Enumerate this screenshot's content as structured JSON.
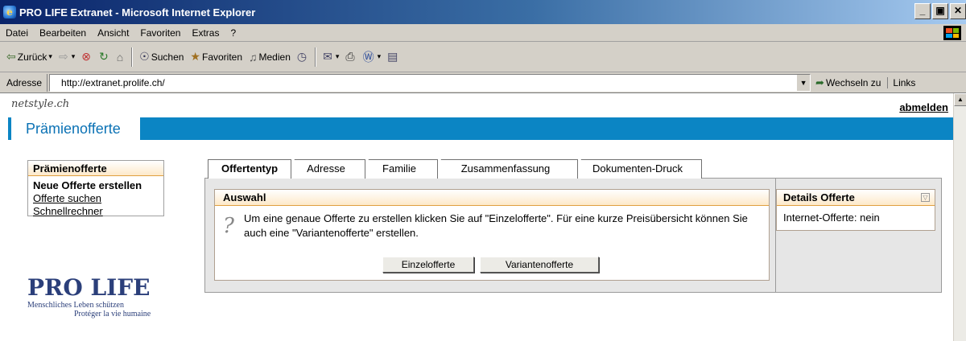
{
  "window": {
    "title": "PRO LIFE Extranet - Microsoft Internet Explorer",
    "controls": [
      "_",
      "&#x25A1;",
      "x"
    ]
  },
  "menu": [
    "Datei",
    "Bearbeiten",
    "Ansicht",
    "Favoriten",
    "Extras",
    "?"
  ],
  "toolbar": {
    "back": "Zurück",
    "search": "Suchen",
    "favorites": "Favoriten",
    "media": "Medien"
  },
  "address": {
    "label": "Adresse",
    "url": "http://extranet.prolife.ch/",
    "go": "Wechseln zu",
    "links": "Links"
  },
  "page": {
    "brand": "netstyle.ch",
    "logout": "abmelden",
    "banner_title": "Prämienofferte",
    "sidebar": {
      "title": "Prämienofferte",
      "items": [
        "Neue Offerte erstellen",
        "Offerte suchen",
        "Schnellrechner"
      ]
    },
    "logo": {
      "name": "PRO LIFE",
      "tagline_de": "Menschliches Leben schützen",
      "tagline_fr": "Protéger la vie humaine"
    },
    "tabs": [
      "Offertentyp",
      "Adresse",
      "Familie",
      "Zusammenfassung",
      "Dokumenten-Druck"
    ],
    "selection": {
      "title": "Auswahl",
      "text": "Um eine genaue Offerte zu erstellen klicken Sie auf \"Einzelofferte\". Für eine kurze Preisübersicht können Sie auch eine \"Variantenofferte\" erstellen.",
      "button_single": "Einzelofferte",
      "button_variant": "Variantenofferte"
    },
    "details": {
      "title": "Details Offerte",
      "text": "Internet-Offerte: nein"
    }
  },
  "colors": {
    "banner": "#0b85c4",
    "box_header": "#fde9c9",
    "logo": "#2b3f7a"
  }
}
